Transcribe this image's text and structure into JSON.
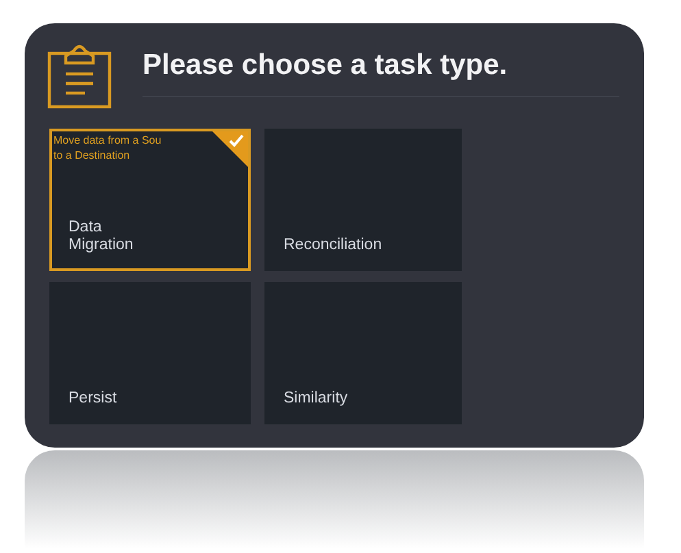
{
  "title": "Please choose a task type.",
  "tasks": [
    {
      "label": "Data\nMigration",
      "selected": true,
      "description_lines": [
        "Move data from a Sou",
        "to a Destination"
      ]
    },
    {
      "label": "Reconciliation",
      "selected": false
    },
    {
      "label": "Persist",
      "selected": false
    },
    {
      "label": "Similarity",
      "selected": false
    }
  ]
}
